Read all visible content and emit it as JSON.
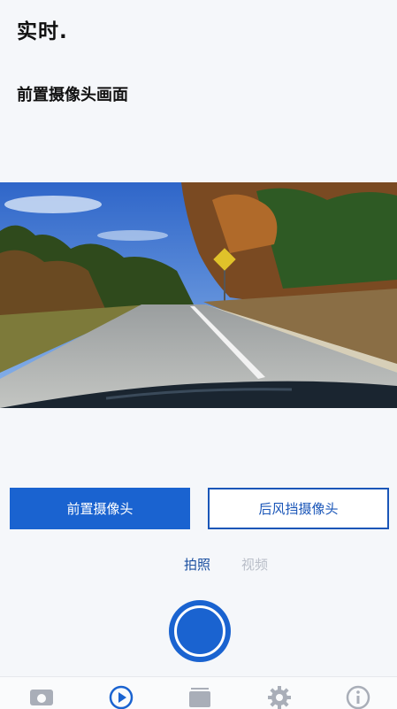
{
  "header": {
    "title": "实时."
  },
  "camera_view": {
    "label": "前置摄像头画面"
  },
  "camera_selector": {
    "front_label": "前置摄像头",
    "rear_label": "后风挡摄像头",
    "selected": "front"
  },
  "mode_selector": {
    "photo_label": "拍照",
    "video_label": "视频",
    "selected": "photo"
  },
  "tabbar": {
    "icons": [
      "dashcam-icon",
      "play-icon",
      "gallery-icon",
      "gear-icon",
      "info-icon"
    ],
    "active": "play-icon"
  },
  "colors": {
    "accent": "#1a63d0",
    "outline": "#1a56b8",
    "inactive": "#b9bec8",
    "background": "#f5f7fa"
  }
}
